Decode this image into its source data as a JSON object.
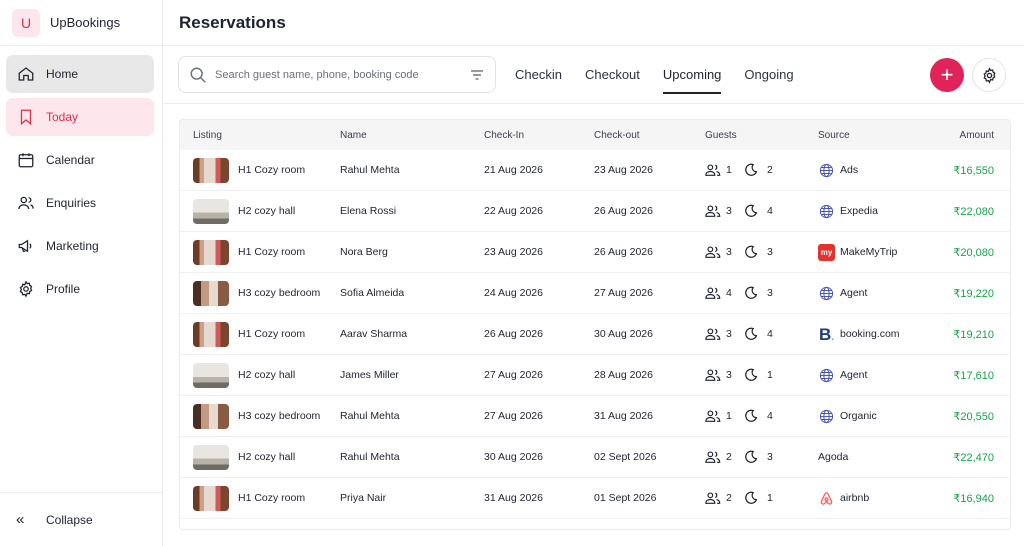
{
  "brand": {
    "initial": "U",
    "name": "UpBookings"
  },
  "nav": [
    {
      "label": "Home",
      "icon": "home-icon"
    },
    {
      "label": "Today",
      "icon": "bookmark-icon"
    },
    {
      "label": "Calendar",
      "icon": "calendar-icon"
    },
    {
      "label": "Enquiries",
      "icon": "users-icon"
    },
    {
      "label": "Marketing",
      "icon": "megaphone-icon"
    },
    {
      "label": "Profile",
      "icon": "settings-icon"
    }
  ],
  "collapse_label": "Collapse",
  "page_title": "Reservations",
  "search": {
    "placeholder": "Search guest name, phone, booking code"
  },
  "tabs": [
    "Checkin",
    "Checkout",
    "Upcoming",
    "Ongoing"
  ],
  "active_tab": "Upcoming",
  "colors": {
    "accent": "#e0245a",
    "today_bg": "#fde6ec",
    "amount": "#18a34a"
  },
  "table": {
    "headers": {
      "listing": "Listing",
      "name": "Name",
      "check_in": "Check-In",
      "check_out": "Check-out",
      "guests": "Guests",
      "source": "Source",
      "amount": "Amount"
    },
    "rows": [
      {
        "listing": "H1 Cozy room",
        "thumb": "room",
        "name": "Rahul Mehta",
        "check_in": "21 Aug 2026",
        "check_out": "23 Aug 2026",
        "guests": "1",
        "nights": "2",
        "source": "Ads",
        "source_icon": "globe-icon",
        "amount": "₹16,550"
      },
      {
        "listing": "H2 cozy hall",
        "thumb": "hall",
        "name": "Elena Rossi",
        "check_in": "22 Aug 2026",
        "check_out": "26 Aug 2026",
        "guests": "3",
        "nights": "4",
        "source": "Expedia",
        "source_icon": "globe-icon",
        "amount": "₹22,080"
      },
      {
        "listing": "H1 Cozy room",
        "thumb": "room",
        "name": "Nora Berg",
        "check_in": "23 Aug 2026",
        "check_out": "26 Aug 2026",
        "guests": "3",
        "nights": "3",
        "source": "MakeMyTrip",
        "source_icon": "makemytrip-icon",
        "amount": "₹20,080"
      },
      {
        "listing": "H3 cozy bedroom",
        "thumb": "bed",
        "name": "Sofia Almeida",
        "check_in": "24 Aug 2026",
        "check_out": "27 Aug 2026",
        "guests": "4",
        "nights": "3",
        "source": "Agent",
        "source_icon": "globe-icon",
        "amount": "₹19,220"
      },
      {
        "listing": "H1 Cozy room",
        "thumb": "room",
        "name": "Aarav Sharma",
        "check_in": "26 Aug 2026",
        "check_out": "30 Aug 2026",
        "guests": "3",
        "nights": "4",
        "source": "booking.com",
        "source_icon": "booking-icon",
        "amount": "₹19,210"
      },
      {
        "listing": "H2 cozy hall",
        "thumb": "hall",
        "name": "James Miller",
        "check_in": "27 Aug 2026",
        "check_out": "28 Aug 2026",
        "guests": "3",
        "nights": "1",
        "source": "Agent",
        "source_icon": "globe-icon",
        "amount": "₹17,610"
      },
      {
        "listing": "H3 cozy bedroom",
        "thumb": "bed",
        "name": "Rahul Mehta",
        "check_in": "27 Aug 2026",
        "check_out": "31 Aug 2026",
        "guests": "1",
        "nights": "4",
        "source": "Organic",
        "source_icon": "globe-icon",
        "amount": "₹20,550"
      },
      {
        "listing": "H2 cozy hall",
        "thumb": "hall",
        "name": "Rahul Mehta",
        "check_in": "30 Aug 2026",
        "check_out": "02 Sept 2026",
        "guests": "2",
        "nights": "3",
        "source": "Agoda",
        "source_icon": "",
        "amount": "₹22,470"
      },
      {
        "listing": "H1 Cozy room",
        "thumb": "room",
        "name": "Priya Nair",
        "check_in": "31 Aug 2026",
        "check_out": "01 Sept 2026",
        "guests": "2",
        "nights": "1",
        "source": "airbnb",
        "source_icon": "airbnb-icon",
        "amount": "₹16,940"
      }
    ]
  }
}
